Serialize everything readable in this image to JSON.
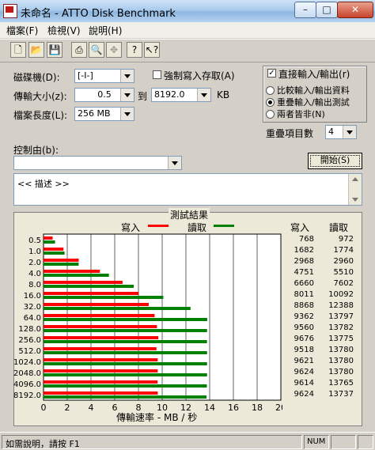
{
  "window": {
    "title": "未命名 - ATTO Disk Benchmark",
    "min": "–",
    "max": "□",
    "close": "✕"
  },
  "menu": [
    "檔案(F)",
    "檢視(V)",
    "說明(H)"
  ],
  "toolbar": [
    "new-icon",
    "open-icon",
    "save-icon",
    "print-icon",
    "print-preview-icon",
    "move-icon",
    "help-icon",
    "context-help-icon"
  ],
  "form": {
    "drive_label": "磁碟機(D):",
    "drive_value": "[-I-]",
    "force_write_label": "強制寫入存取(A)",
    "force_write_checked": false,
    "direct_io_label": "直接輸入/輸出(r)",
    "direct_io_checked": true,
    "transfer_label": "傳輸大小(z):",
    "transfer_from": "0.5",
    "to_label": "到",
    "transfer_to": "8192.0",
    "unit": "KB",
    "filelen_label": "檔案長度(L):",
    "filelen_value": "256 MB",
    "radio1": "比較輸入/輸出資料",
    "radio2": "重疊輸入/輸出測試",
    "radio3": "兩者皆非(N)",
    "selected_radio": 2,
    "queue_label": "重疊項目數",
    "queue_value": "4",
    "control_label": "控制由(b):",
    "control_value": "",
    "start_button": "開始(S)",
    "description": "<<   描述   >>"
  },
  "results": {
    "title": "測試結果",
    "legend_write": "寫入",
    "legend_read": "讀取",
    "col_write": "寫入",
    "col_read": "讀取",
    "write_color": "#ff0000",
    "read_color": "#008000",
    "x_ticks": [
      "0",
      "2",
      "4",
      "6",
      "8",
      "10",
      "12",
      "14",
      "16",
      "18",
      "20"
    ],
    "x_label": "傳輸速率 - MB / 秒"
  },
  "chart_data": {
    "type": "bar",
    "orientation": "horizontal",
    "title": "測試結果",
    "xlabel": "傳輸速率 - MB / 秒",
    "xlim": [
      0,
      20
    ],
    "categories": [
      "0.5",
      "1.0",
      "2.0",
      "4.0",
      "8.0",
      "16.0",
      "32.0",
      "64.0",
      "128.0",
      "256.0",
      "512.0",
      "1024.0",
      "2048.0",
      "4096.0",
      "8192.0"
    ],
    "series": [
      {
        "name": "寫入",
        "values": [
          768,
          1682,
          2968,
          4751,
          6660,
          8011,
          8868,
          9362,
          9560,
          9676,
          9518,
          9621,
          9624,
          9614,
          9624
        ]
      },
      {
        "name": "讀取",
        "values": [
          972,
          1774,
          2960,
          5510,
          7602,
          10092,
          12388,
          13797,
          13782,
          13775,
          13780,
          13780,
          13780,
          13765,
          13737
        ]
      }
    ],
    "value_unit_note": "bar length = value / 1000 on 0–20 axis"
  },
  "status": {
    "text": "如需說明，請按 F1",
    "num": "NUM"
  }
}
